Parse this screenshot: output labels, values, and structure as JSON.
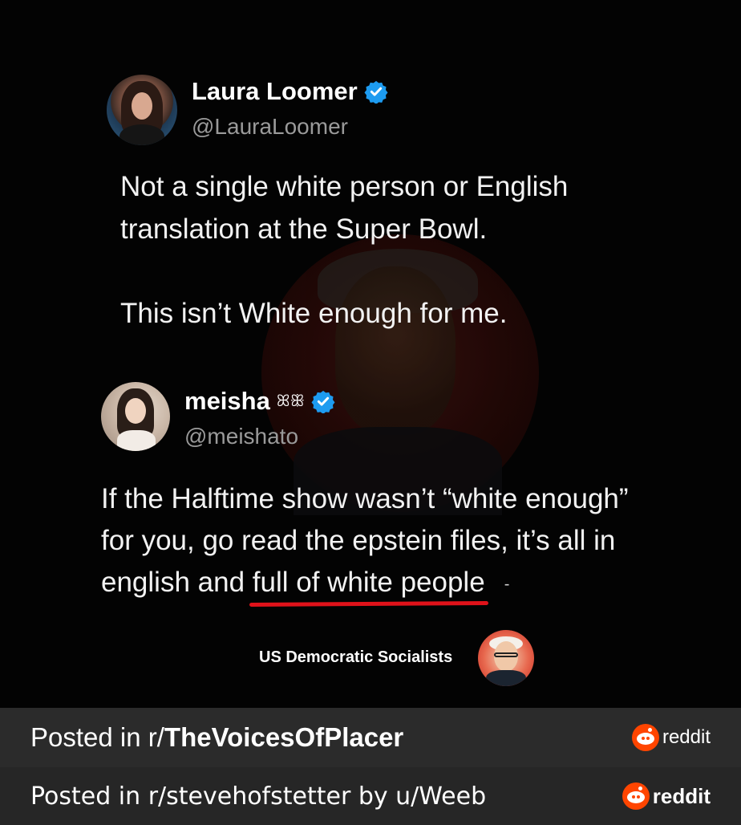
{
  "tweet1": {
    "name": "Laura Loomer",
    "handle": "@LauraLoomer",
    "line1": "Not a single white person or English",
    "line2": "translation at the Super Bowl.",
    "line3": "This isn’t White enough for me."
  },
  "tweet2": {
    "name": "meisha",
    "name_emoji": "ꕤꕥ",
    "handle": "@meishato",
    "line1": "If the Halftime show wasn’t “white enough”",
    "line2": "for you, go read the epstein files, it’s all in",
    "line3_start": "english and ",
    "line3_underlined": "full of white people",
    "trailing_mark": "-"
  },
  "attribution": {
    "label": "US Democratic Socialists"
  },
  "footer1": {
    "prefix": "Posted in r/",
    "subreddit": "TheVoicesOfPlacer",
    "brand": "reddit"
  },
  "footer2": {
    "text": "Posted in r/stevehofstetter by u/Weeb",
    "brand": "reddit"
  },
  "colors": {
    "verified": "#1d9bf0",
    "underline": "#e0121a",
    "reddit_orange": "#ff4500"
  }
}
